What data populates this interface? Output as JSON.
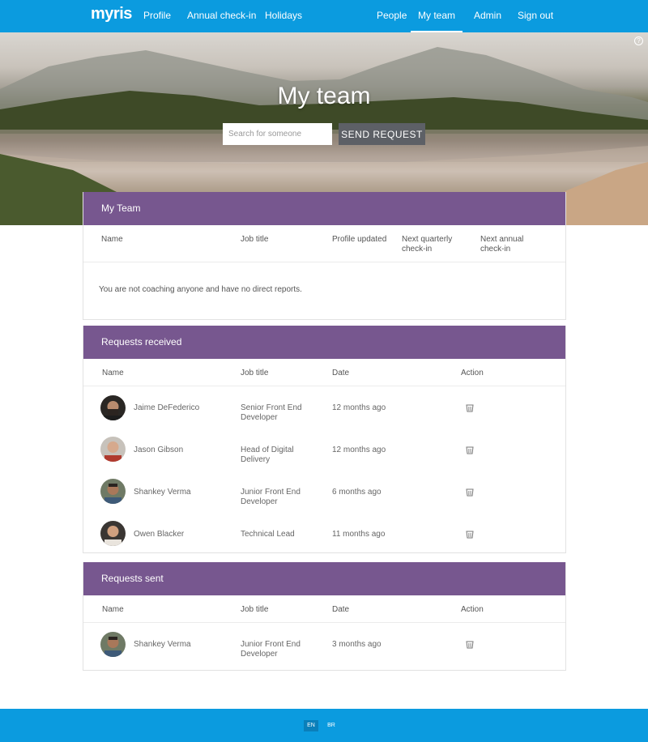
{
  "nav": {
    "logo": "myris",
    "links": [
      "Profile",
      "Annual check-in",
      "Holidays",
      "People",
      "My team",
      "Admin",
      "Sign out"
    ],
    "active": "My team"
  },
  "hero": {
    "title": "My team",
    "search_placeholder": "Search for someone",
    "send_button": "SEND REQUEST",
    "help_icon": "help-circle-icon"
  },
  "my_team": {
    "title": "My Team",
    "columns": [
      "Name",
      "Job title",
      "Profile updated",
      "Next quarterly check-in",
      "Next annual check-in"
    ],
    "empty_message": "You are not coaching anyone and have no direct reports."
  },
  "requests_received": {
    "title": "Requests received",
    "columns": [
      "Name",
      "Job title",
      "Date",
      "Action"
    ],
    "rows": [
      {
        "name": "Jaime DeFederico",
        "job_line1": "Senior Front End",
        "job_line2": "Developer",
        "date": "12 months ago",
        "action_icon": "trash-icon"
      },
      {
        "name": "Jason Gibson",
        "job_line1": "Head of Digital",
        "job_line2": "Delivery",
        "date": "12 months ago",
        "action_icon": "trash-icon"
      },
      {
        "name": "Shankey Verma",
        "job_line1": "Junior Front End",
        "job_line2": "Developer",
        "date": "6 months ago",
        "action_icon": "trash-icon"
      },
      {
        "name": "Owen Blacker",
        "job_line1": "Technical Lead",
        "job_line2": "",
        "date": "11 months ago",
        "action_icon": "trash-icon"
      }
    ]
  },
  "requests_sent": {
    "title": "Requests sent",
    "columns": [
      "Name",
      "Job title",
      "Date",
      "Action"
    ],
    "rows": [
      {
        "name": "Shankey Verma",
        "job_line1": "Junior Front End",
        "job_line2": "Developer",
        "date": "3 months ago",
        "action_icon": "trash-icon"
      }
    ]
  },
  "footer": {
    "languages": [
      "EN",
      "BR"
    ],
    "active_language": "EN"
  },
  "colors": {
    "primary": "#0b9bdf",
    "card_header": "#77578f",
    "button": "#5d6066"
  }
}
